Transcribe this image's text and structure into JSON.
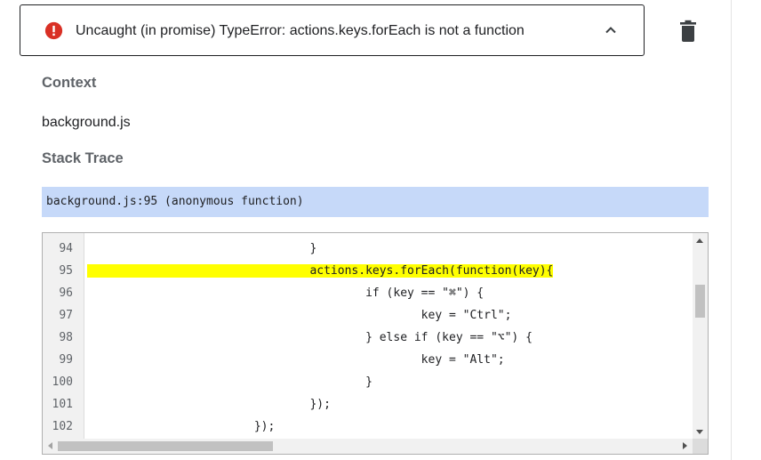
{
  "error": {
    "message": "Uncaught (in promise) TypeError: actions.keys.forEach is not a function",
    "icon": "error-icon",
    "icon_color": "#d93025"
  },
  "context": {
    "heading": "Context",
    "value": "background.js"
  },
  "stack_trace": {
    "heading": "Stack Trace",
    "frame": "background.js:95 (anonymous function)",
    "frame_bg": "#c6d9f9"
  },
  "code": {
    "highlight_color": "#ffff00",
    "highlighted_line": "95",
    "lines": [
      {
        "num": "94",
        "text": "                                }"
      },
      {
        "num": "95",
        "text": "                                actions.keys.forEach(function(key){"
      },
      {
        "num": "96",
        "text": "                                        if (key == \"⌘\") {"
      },
      {
        "num": "97",
        "text": "                                                key = \"Ctrl\";"
      },
      {
        "num": "98",
        "text": "                                        } else if (key == \"⌥\") {"
      },
      {
        "num": "99",
        "text": "                                                key = \"Alt\";"
      },
      {
        "num": "100",
        "text": "                                        }"
      },
      {
        "num": "101",
        "text": "                                });"
      },
      {
        "num": "102",
        "text": "                        });"
      }
    ]
  }
}
